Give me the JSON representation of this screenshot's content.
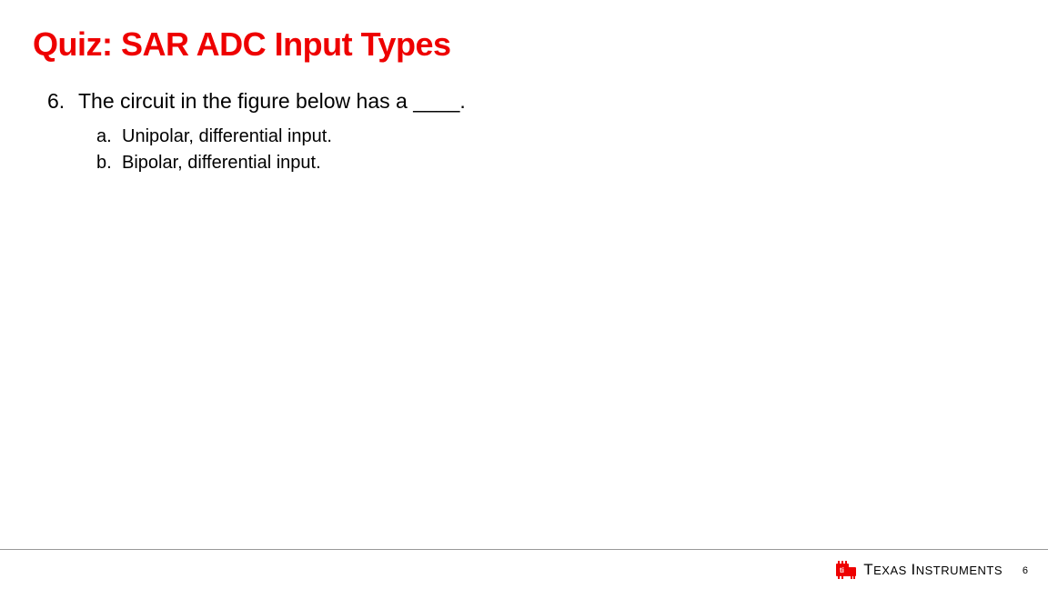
{
  "title": "Quiz: SAR ADC Input Types",
  "question": {
    "number": "6.",
    "text": "The circuit in the figure below has a ____."
  },
  "options": [
    {
      "letter": "a.",
      "text": "Unipolar, differential input."
    },
    {
      "letter": "b.",
      "text": "Bipolar, differential input."
    }
  ],
  "footer": {
    "brand_first": "T",
    "brand_rest_1": "EXAS",
    "brand_space": " ",
    "brand_first_2": "I",
    "brand_rest_2": "NSTRUMENTS",
    "page_number": "6",
    "logo_color": "#ee0000"
  }
}
